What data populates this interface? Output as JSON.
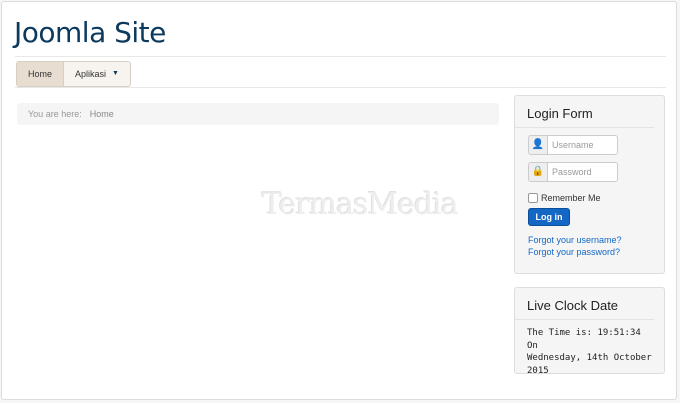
{
  "site": {
    "title": "Joomla Site"
  },
  "nav": {
    "items": [
      {
        "label": "Home"
      },
      {
        "label": "Aplikasi"
      }
    ]
  },
  "breadcrumb": {
    "prefix": "You are here:",
    "current": "Home"
  },
  "watermark": "TermasMedia",
  "login": {
    "title": "Login Form",
    "username_placeholder": "Username",
    "password_placeholder": "Password",
    "remember_label": "Remember Me",
    "button_label": "Log in",
    "forgot_username": "Forgot your username?",
    "forgot_password": "Forgot your password?"
  },
  "clock": {
    "title": "Live Clock Date",
    "line1": "The Time is: 19:51:34 On",
    "line2": "Wednesday, 14th October",
    "line3": "2015"
  },
  "icons": {
    "nav_caret": "caret-down-icon",
    "user": "user-icon",
    "lock": "lock-icon"
  },
  "colors": {
    "title": "#0b3a5e",
    "link": "#1467c4",
    "button": "#1467c4"
  }
}
